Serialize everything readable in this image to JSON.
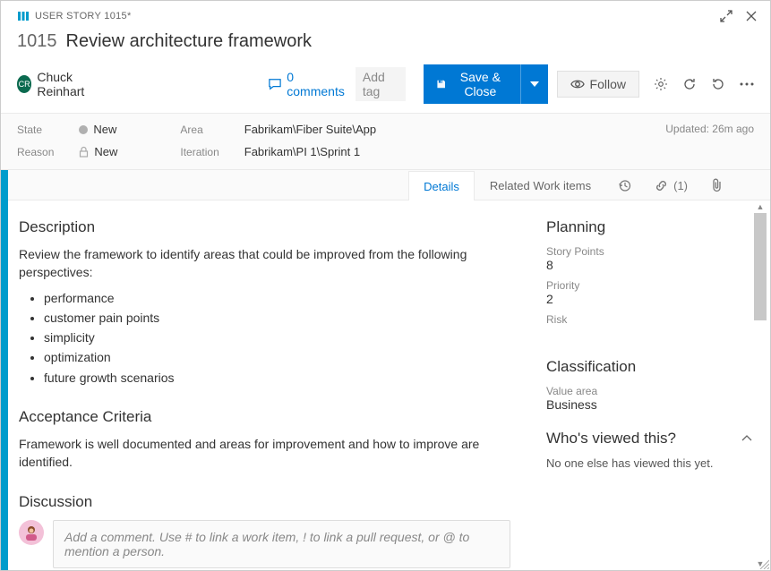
{
  "header": {
    "type_label": "USER STORY 1015*",
    "id": "1015",
    "title": "Review architecture framework"
  },
  "cmdbar": {
    "assignee_initials": "CR",
    "assignee_name": "Chuck Reinhart",
    "comments_count": "0 comments",
    "add_tag": "Add tag",
    "save_label": "Save & Close",
    "follow_label": "Follow"
  },
  "fields": {
    "state_label": "State",
    "state_value": "New",
    "reason_label": "Reason",
    "reason_value": "New",
    "area_label": "Area",
    "area_value": "Fabrikam\\Fiber Suite\\App",
    "iteration_label": "Iteration",
    "iteration_value": "Fabrikam\\PI 1\\Sprint 1",
    "updated": "Updated: 26m ago"
  },
  "tabs": {
    "details": "Details",
    "related": "Related Work items",
    "links_count": "(1)"
  },
  "main": {
    "description_h": "Description",
    "desc_intro": "Review the framework to identify areas that could be improved from the following perspectives:",
    "desc_bullets": [
      "performance",
      "customer pain points",
      "simplicity",
      "optimization",
      "future growth scenarios"
    ],
    "acceptance_h": "Acceptance Criteria",
    "acceptance_text": "Framework is well documented and areas for improvement and how to improve are identified.",
    "discussion_h": "Discussion",
    "comment_placeholder": "Add a comment. Use # to link a work item, ! to link a pull request, or @ to mention a person."
  },
  "side": {
    "planning_h": "Planning",
    "sp_label": "Story Points",
    "sp_value": "8",
    "priority_label": "Priority",
    "priority_value": "2",
    "risk_label": "Risk",
    "classification_h": "Classification",
    "va_label": "Value area",
    "va_value": "Business",
    "who_h": "Who's viewed this?",
    "who_text": "No one else has viewed this yet."
  }
}
